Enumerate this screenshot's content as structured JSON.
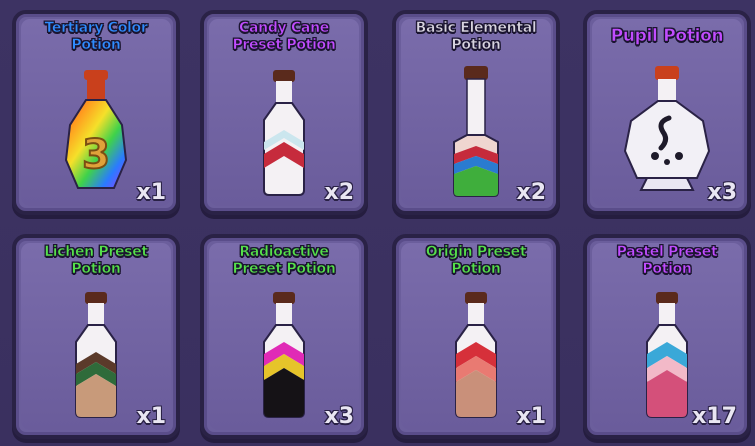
{
  "inventory": {
    "items": [
      {
        "name": "Tertiary Color Potion",
        "title_lines": [
          "Tertiary Color",
          "Potion"
        ],
        "count": "x1",
        "title_color": "#2f8cff",
        "icon": "rainbow-flask-icon"
      },
      {
        "name": "Candy Cane Preset Potion",
        "title_lines": [
          "Candy Cane",
          "Preset Potion"
        ],
        "count": "x2",
        "title_color": "#c14cff",
        "icon": "candy-cane-bottle-icon"
      },
      {
        "name": "Basic Elemental Potion",
        "title_lines": [
          "Basic Elemental",
          "Potion"
        ],
        "count": "x2",
        "title_color": "#d7d3df",
        "icon": "elemental-bottle-icon"
      },
      {
        "name": "Pupil Potion",
        "title_lines": [
          "Pupil Potion"
        ],
        "count": "x3",
        "title_color": "#c14cff",
        "icon": "pupil-flask-icon"
      },
      {
        "name": "Lichen Preset Potion",
        "title_lines": [
          "Lichen Preset",
          "Potion"
        ],
        "count": "x1",
        "title_color": "#55e04a",
        "icon": "lichen-bottle-icon"
      },
      {
        "name": "Radioactive Preset Potion",
        "title_lines": [
          "Radioactive",
          "Preset Potion"
        ],
        "count": "x3",
        "title_color": "#55e04a",
        "icon": "radioactive-bottle-icon"
      },
      {
        "name": "Origin Preset Potion",
        "title_lines": [
          "Origin Preset",
          "Potion"
        ],
        "count": "x1",
        "title_color": "#55e04a",
        "icon": "origin-bottle-icon"
      },
      {
        "name": "Pastel Preset Potion",
        "title_lines": [
          "Pastel Preset",
          "Potion"
        ],
        "count": "x17",
        "title_color": "#c14cff",
        "icon": "pastel-bottle-icon"
      }
    ]
  }
}
